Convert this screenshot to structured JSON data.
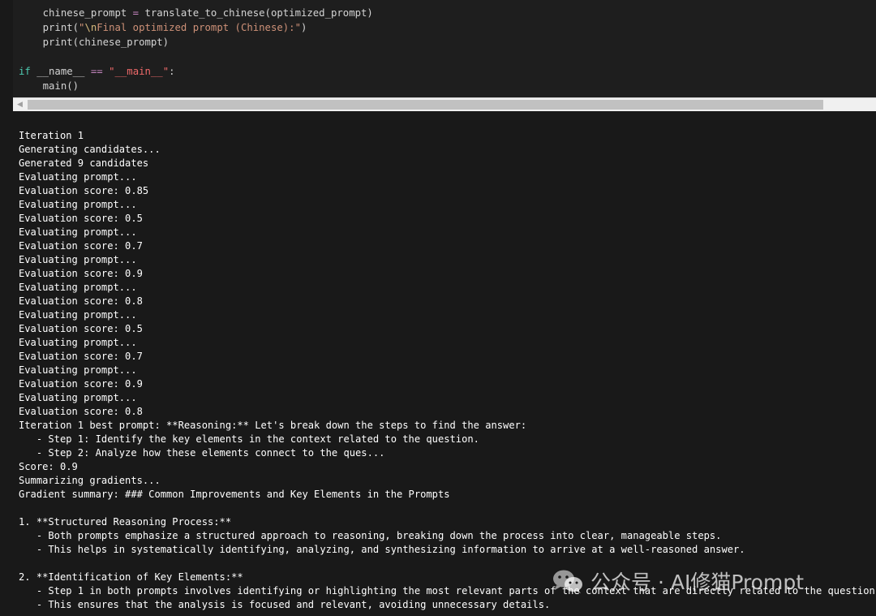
{
  "code": {
    "line1": {
      "a": "    chinese_prompt ",
      "op": "=",
      "b": " translate_to_chinese(optimized_prompt)"
    },
    "line2": {
      "a": "    print(",
      "q1": "\"",
      "esc": "\\n",
      "s": "Final optimized prompt (Chinese):",
      "q2": "\"",
      "b": ")"
    },
    "line3": "    print(chinese_prompt)",
    "line5": {
      "kw": "if",
      "a": " __name__ ",
      "op": "==",
      "sp": " ",
      "str": "\"__main__\"",
      "b": ":"
    },
    "line6": "    main()"
  },
  "scrollbar": {
    "left_arrow": "◀"
  },
  "output_lines": [
    "Iteration 1",
    "Generating candidates...",
    "Generated 9 candidates",
    "Evaluating prompt...",
    "Evaluation score: 0.85",
    "Evaluating prompt...",
    "Evaluation score: 0.5",
    "Evaluating prompt...",
    "Evaluation score: 0.7",
    "Evaluating prompt...",
    "Evaluation score: 0.9",
    "Evaluating prompt...",
    "Evaluation score: 0.8",
    "Evaluating prompt...",
    "Evaluation score: 0.5",
    "Evaluating prompt...",
    "Evaluation score: 0.7",
    "Evaluating prompt...",
    "Evaluation score: 0.9",
    "Evaluating prompt...",
    "Evaluation score: 0.8",
    "Iteration 1 best prompt: **Reasoning:** Let's break down the steps to find the answer:",
    "   - Step 1: Identify the key elements in the context related to the question.",
    "   - Step 2: Analyze how these elements connect to the ques...",
    "Score: 0.9",
    "Summarizing gradients...",
    "Gradient summary: ### Common Improvements and Key Elements in the Prompts",
    "",
    "1. **Structured Reasoning Process:**",
    "   - Both prompts emphasize a structured approach to reasoning, breaking down the process into clear, manageable steps.",
    "   - This helps in systematically identifying, analyzing, and synthesizing information to arrive at a well-reasoned answer.",
    "",
    "2. **Identification of Key Elements:**",
    "   - Step 1 in both prompts involves identifying or highlighting the most relevant parts of the context that are directly related to the question.",
    "   - This ensures that the analysis is focused and relevant, avoiding unnecessary details."
  ],
  "watermark": {
    "icon": "wechat-icon",
    "text": "公众号 · AI修猫Prompt"
  },
  "colors": {
    "keyword": "#4ec9b0",
    "operator": "#c586c0",
    "string": "#ce9178",
    "escape": "#d7ba7d",
    "dunder_string": "#f06a6a",
    "background": "#191919"
  }
}
